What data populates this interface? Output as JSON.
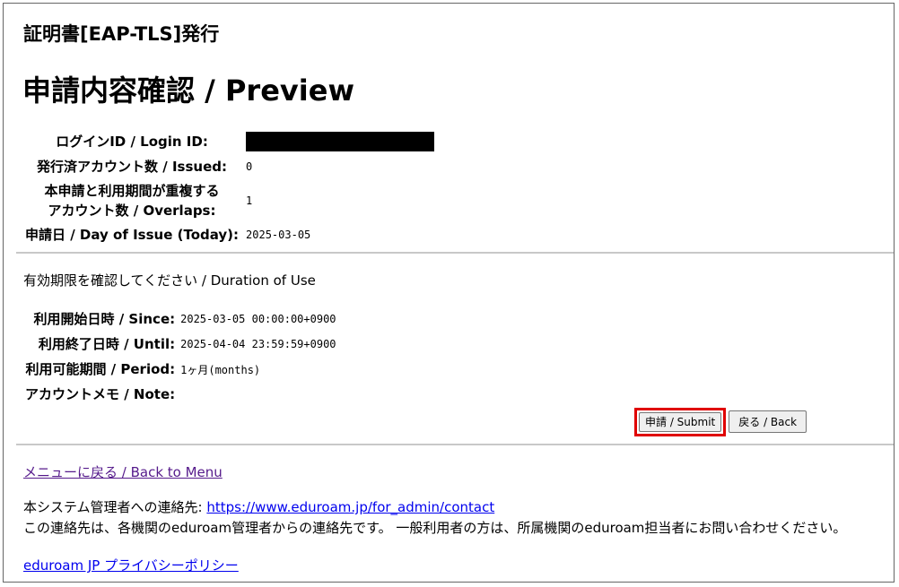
{
  "header": {
    "heading": "証明書[EAP-TLS]発行",
    "title": "申請内容確認 / Preview"
  },
  "info": {
    "login_label": "ログインID / Login ID:",
    "issued_label": "発行済アカウント数 / Issued:",
    "issued_value": "0",
    "overlaps_label_line1": "本申請と利用期間が重複する",
    "overlaps_label_line2": "アカウント数 / Overlaps:",
    "overlaps_value": "1",
    "issue_date_label": "申請日 / Day of Issue (Today):",
    "issue_date_value": "2025-03-05"
  },
  "duration": {
    "prompt": "有効期限を確認してください / Duration of Use",
    "since_label": "利用開始日時 / Since:",
    "since_value": "2025-03-05 00:00:00+0900",
    "until_label": "利用終了日時 / Until:",
    "until_value": "2025-04-04 23:59:59+0900",
    "period_label": "利用可能期間 / Period:",
    "period_value": "1ヶ月(months)",
    "note_label": "アカウントメモ / Note:",
    "note_value": ""
  },
  "buttons": {
    "submit_label": "申請 / Submit",
    "back_label": "戻る / Back"
  },
  "footer": {
    "menu_link": "メニューに戻る / Back to Menu",
    "contact_prefix": "本システム管理者への連絡先: ",
    "contact_url": "https://www.eduroam.jp/for_admin/contact",
    "contact_note": "この連絡先は、各機関のeduroam管理者からの連絡先です。 一般利用者の方は、所属機関のeduroam担当者にお問い合わせください。",
    "privacy_link": "eduroam JP プライバシーポリシー"
  },
  "colors": {
    "highlight": "#e00000",
    "visited_link": "#551a8b",
    "link": "#0000ee"
  }
}
